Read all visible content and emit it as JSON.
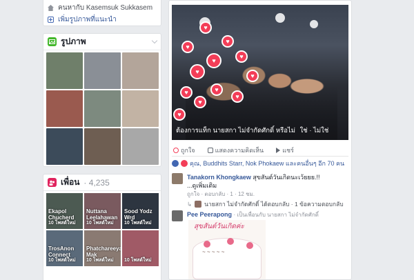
{
  "about": {
    "lives_in": "คนหากับ Kasemsuk Sukkasem",
    "add_link": "เพิ่มรูปภาพที่แนะนำ"
  },
  "photos": {
    "title": "รูปภาพ",
    "thumb_colors": [
      "#6f7f6a",
      "#8a8f96",
      "#b3a59a",
      "#9a5a4f",
      "#7d8a7f",
      "#c2b3a4",
      "#3c4b5a",
      "#6e5e52",
      "#a8a8a8"
    ]
  },
  "friends": {
    "title": "เพื่อน",
    "count": "· 4,235",
    "items": [
      {
        "name": "Ekapol Chucherd",
        "new": "10 โพสต์ใหม่",
        "color": "#4c5a52"
      },
      {
        "name": "Nuttana Leelahawan",
        "new": "10 โพสต์ใหม่",
        "color": "#7a5a5f"
      },
      {
        "name": "Sood Yodz Wrd",
        "new": "10 โพสต์ใหม่",
        "color": "#2d3540"
      },
      {
        "name": "TrosAnon Connect",
        "new": "10 โพสต์ใหม่",
        "color": "#5a6a7a"
      },
      {
        "name": "Phatchareeya Mak",
        "new": "10 โพสต์ใหม่",
        "color": "#8a7a72"
      },
      {
        "name": "",
        "new": "10 โพสต์ใหม่",
        "color": "#a05a66"
      }
    ]
  },
  "post": {
    "caption": "ต้องการแท็ก นายสกา ไม่จำกัดศักดิ์ หรือไม่",
    "caption_actions": "ใช่ · ไม่ใช่",
    "actions": {
      "like": "ถูกใจ",
      "comment": "แสดงความคิดเห็น",
      "share": "แชร์"
    },
    "reactions_text": "คุณ, Buddhits Starr, Nok Phokaew และคนอื่นๆ อีก 70 คน",
    "comment1": {
      "name": "Tanakorn Khongkaew",
      "text": "สุขสันต์วันเกิดนะเว้ยยย.!!",
      "sub": "...ดูเพิ่มเติม",
      "meta": "ถูกใจ · ตอบกลับ · 1 · 12 ชม."
    },
    "reply1": {
      "text": "นายสกา ไม่จำกัดศักดิ์ ได้ตอบกลับ · 1 ข้อความตอบกลับ"
    },
    "comment2": {
      "name": "Pee Peerapong",
      "text": "· เป็นเพื่อนกับ นายสกา ไม่จำกัดศักดิ์"
    },
    "cake_title": "สุขสันต์วันเกิดค่ะ"
  }
}
